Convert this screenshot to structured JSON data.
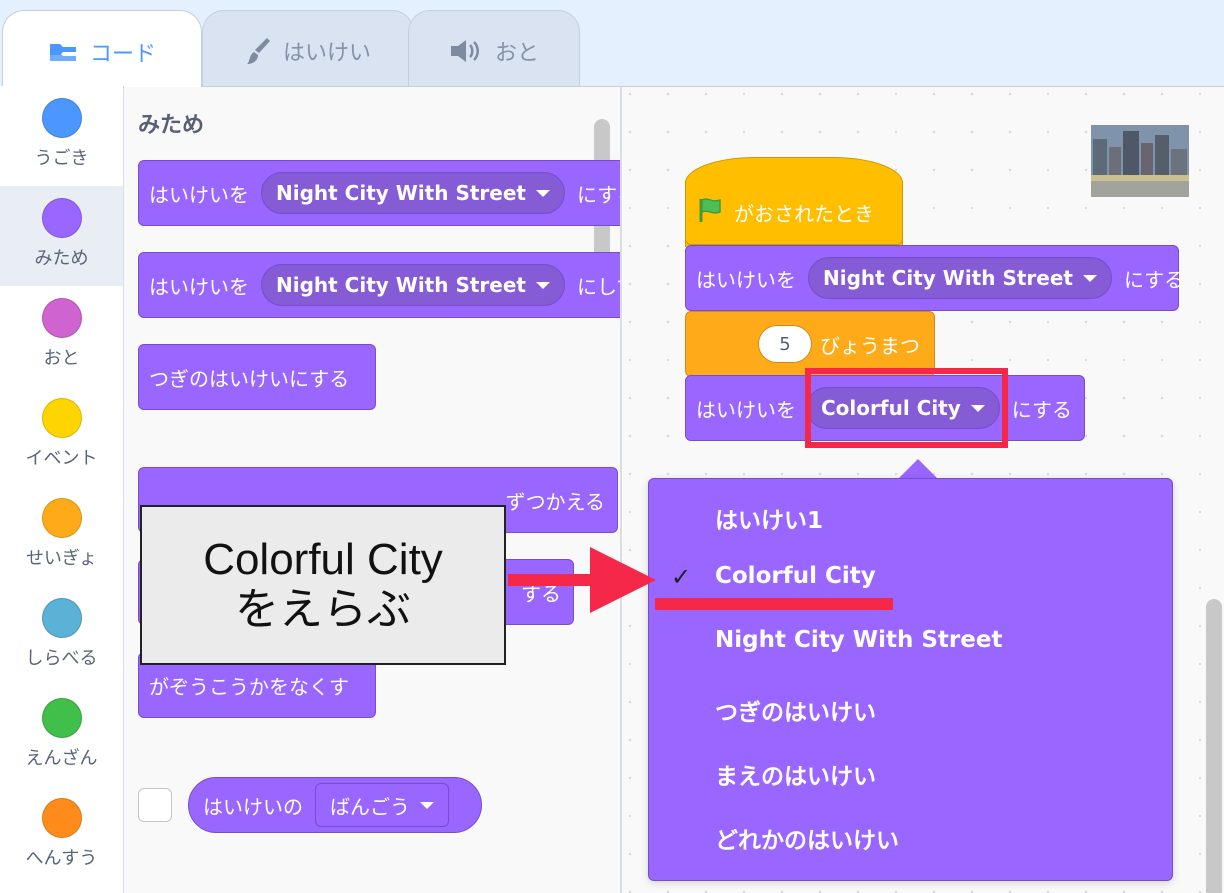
{
  "tabs": [
    {
      "label": "コード",
      "icon": "code-icon"
    },
    {
      "label": "はいけい",
      "icon": "brush-icon"
    },
    {
      "label": "おと",
      "icon": "speaker-icon"
    }
  ],
  "categories": [
    {
      "label": "うごき",
      "color": "#4c97ff"
    },
    {
      "label": "みため",
      "color": "#9966ff"
    },
    {
      "label": "おと",
      "color": "#cf63cf"
    },
    {
      "label": "イベント",
      "color": "#ffd500"
    },
    {
      "label": "せいぎょ",
      "color": "#ffab19"
    },
    {
      "label": "しらべる",
      "color": "#5cb1d6"
    },
    {
      "label": "えんざん",
      "color": "#40bf4a"
    },
    {
      "label": "へんすう",
      "color": "#ff8c1a"
    }
  ],
  "palette": {
    "title": "みため",
    "block1": {
      "prefix": "はいけいを",
      "value": "Night City With Street",
      "suffix": "にする"
    },
    "block2": {
      "prefix": "はいけいを",
      "value": "Night City With Street",
      "suffix": "にして"
    },
    "block3": {
      "text": "つぎのはいけいにする"
    },
    "block4": {
      "suffix": "ずつかえる"
    },
    "block5": {
      "suffix": "する"
    },
    "block6": {
      "text": "がぞうこうかをなくす"
    },
    "reporter": {
      "prefix": "はいけいの",
      "value": "ばんごう"
    }
  },
  "script": {
    "hat": {
      "text": "がおされたとき"
    },
    "s1": {
      "prefix": "はいけいを",
      "value": "Night City With Street",
      "suffix": "にする"
    },
    "s2": {
      "num": "5",
      "suffix": "びょうまつ"
    },
    "s3": {
      "prefix": "はいけいを",
      "value": "Colorful City",
      "suffix": "にする"
    }
  },
  "callout": {
    "line1": "Colorful City",
    "line2": "をえらぶ"
  },
  "menu": {
    "items": [
      "はいけい1",
      "Colorful City",
      "Night City With Street",
      "つぎのはいけい",
      "まえのはいけい",
      "どれかのはいけい"
    ],
    "selected": "Colorful City",
    "check": "✓"
  },
  "colors": {
    "highlight": "#f5284a",
    "looks": "#9966ff",
    "events": "#ffbf00",
    "control": "#ffab19"
  }
}
